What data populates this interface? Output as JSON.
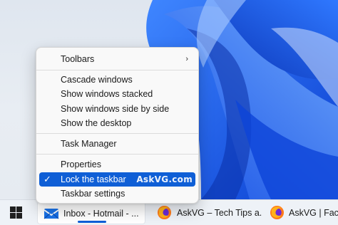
{
  "context_menu": {
    "items": [
      {
        "label": "Toolbars",
        "submenu_glyph": "›"
      },
      {
        "label": "Cascade windows"
      },
      {
        "label": "Show windows stacked"
      },
      {
        "label": "Show windows side by side"
      },
      {
        "label": "Show the desktop"
      },
      {
        "label": "Task Manager"
      },
      {
        "label": "Properties"
      },
      {
        "label": "Lock the taskbar",
        "checked": true,
        "check_glyph": "✓",
        "watermark": "AskVG.com"
      },
      {
        "label": "Taskbar settings"
      }
    ]
  },
  "taskbar": {
    "start_icon": "windows-logo-icon",
    "buttons": [
      {
        "label": "Inbox - Hotmail - ...",
        "icon": "mail-icon"
      },
      {
        "label": "AskVG – Tech Tips a...",
        "icon": "firefox-icon"
      },
      {
        "label": "AskVG | Faceb",
        "icon": "firefox-icon"
      }
    ]
  },
  "colors": {
    "accent": "#0f5fd6",
    "wallpaper_blue": "#1a5cf0",
    "taskbar_bg": "#eef2f7",
    "menu_bg": "#f9f9f9"
  }
}
